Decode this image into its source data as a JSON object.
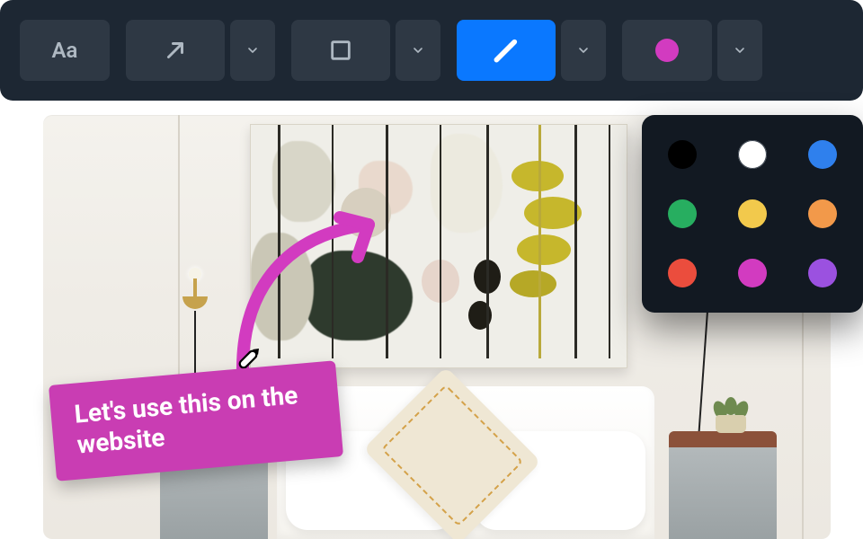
{
  "toolbar": {
    "text_tool_label": "Aa",
    "arrow_tool_icon": "arrow-up-right",
    "shape_tool_icon": "square-outline",
    "draw_tool_icon": "marker",
    "color_tool_icon": "color-dot",
    "active_tool": "draw",
    "selected_color": "#d23bc0"
  },
  "color_picker": {
    "swatches": [
      "#000000",
      "#ffffff",
      "#2f80ed",
      "#27ae60",
      "#f2c94c",
      "#f2994a",
      "#eb4d3d",
      "#d23bc0",
      "#9b51e0"
    ]
  },
  "annotation": {
    "text": "Let's use this on the website",
    "box_color": "#c93db3",
    "arrow_color": "#d23bc0"
  }
}
